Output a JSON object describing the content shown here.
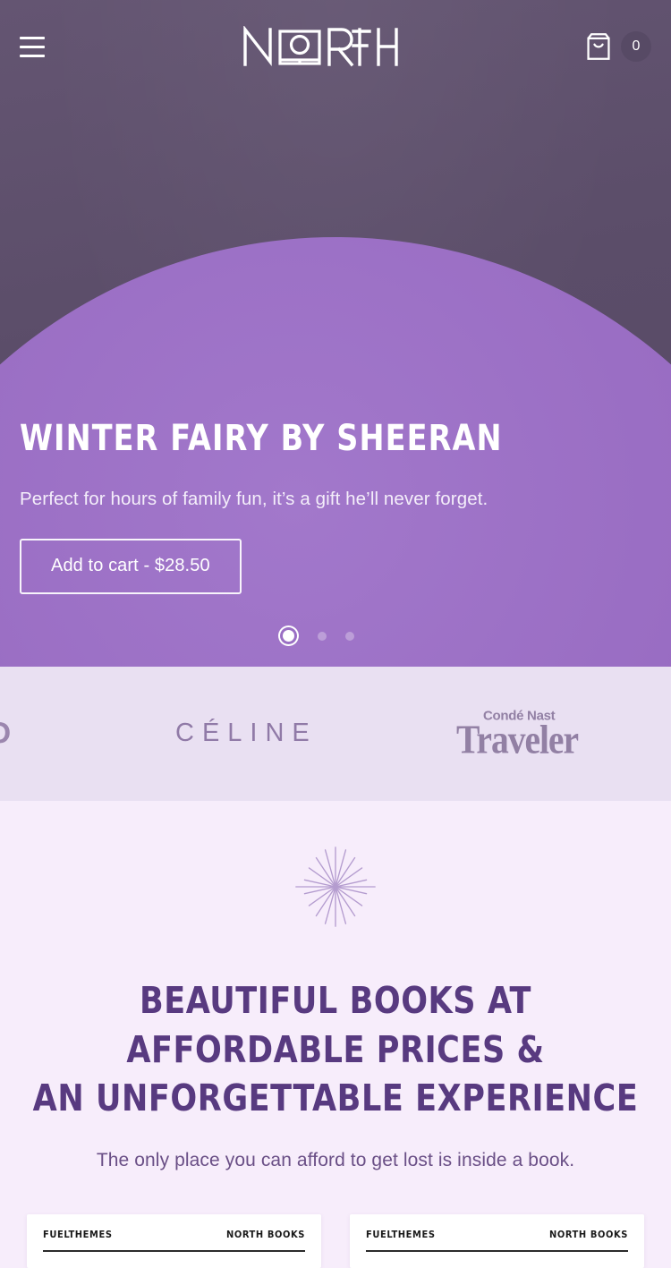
{
  "header": {
    "menu_label": "Menu",
    "logo_text": "NORTH",
    "logo_icon": "book-o-logo",
    "cart_icon": "shopping-bag-icon",
    "cart_count": "0"
  },
  "hero": {
    "title": "WINTER FAIRY BY SHEERAN",
    "subtitle": "Perfect for hours of family fun, it’s a gift he’ll never forget.",
    "cta_label": "Add to cart - $28.50",
    "price": "$28.50",
    "slides": [
      {
        "active": true
      },
      {
        "active": false
      },
      {
        "active": false
      }
    ],
    "colors": {
      "background": "#5d4f6b",
      "circle": "#9a6fc4",
      "text": "#ffffff"
    }
  },
  "brands": {
    "items": [
      {
        "name": "wired",
        "label": "ED"
      },
      {
        "name": "celine",
        "label": "CÉLINE"
      },
      {
        "name": "conde-nast-traveler",
        "label_top": "Condé Nast",
        "label_main": "Traveler"
      }
    ],
    "background": "#e9e0f2"
  },
  "main": {
    "burst_icon": "starburst-icon",
    "heading": "BEAUTIFUL BOOKS AT AFFORDABLE PRICES & AN UNFORGETTABLE EXPERIENCE",
    "heading_line_1": "BEAUTIFUL BOOKS AT AFFORDABLE PRICES &",
    "heading_line_2": "AN UNFORGETTABLE EXPERIENCE",
    "subheading": "The only place you can afford to get lost is inside a book.",
    "background": "#f7edfb",
    "heading_color": "#583a80",
    "cards": [
      {
        "left_label": "FUELTHEMES",
        "right_label": "NORTH BOOKS"
      },
      {
        "left_label": "FUELTHEMES",
        "right_label": "NORTH BOOKS"
      }
    ]
  }
}
